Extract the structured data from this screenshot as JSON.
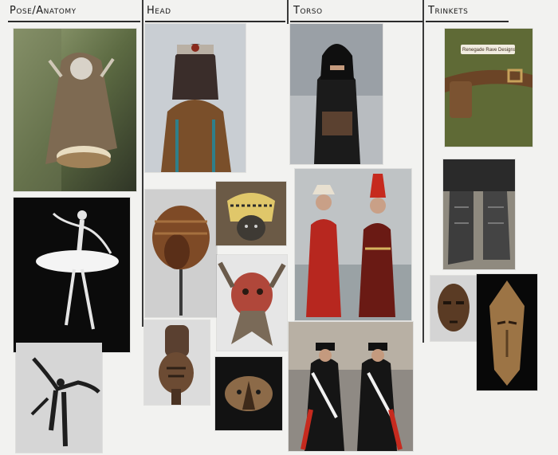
{
  "columns": [
    {
      "label": "Pose/Anatomy"
    },
    {
      "label": "Head"
    },
    {
      "label": "Torso"
    },
    {
      "label": "Trinkets"
    }
  ],
  "belt_tag": "Renegade Rave Designs",
  "palette": {
    "board": "#f2f2f0",
    "ink": "#1a1a1a",
    "black_bg": "#0b0b0b",
    "red_robe": "#b7271f",
    "leather": "#6b4426",
    "olive": "#5f6a36"
  }
}
